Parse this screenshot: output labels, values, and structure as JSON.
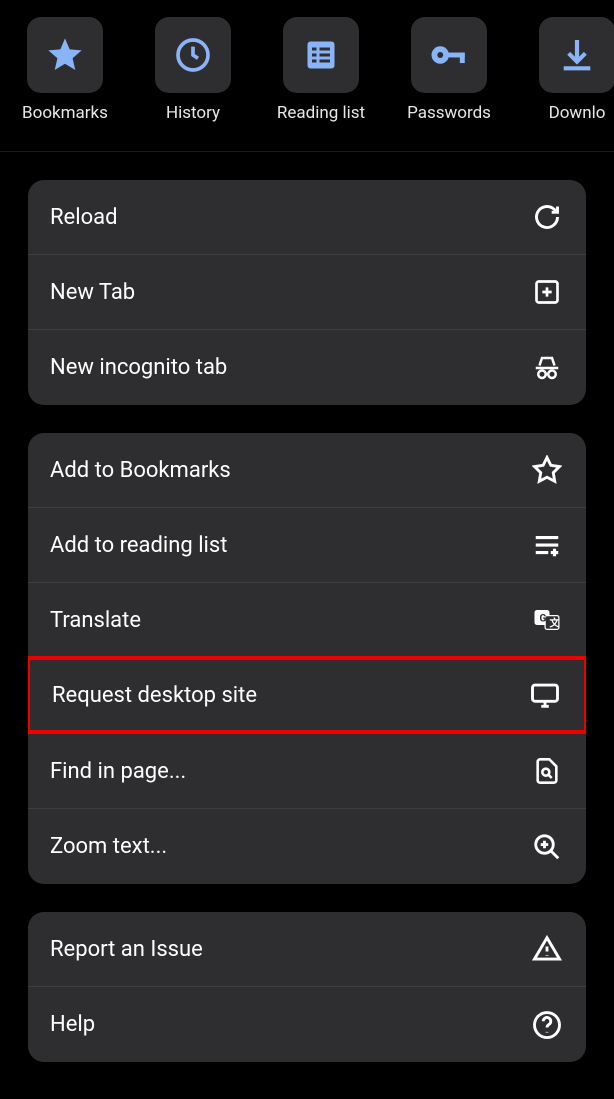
{
  "topRow": {
    "bookmarks": "Bookmarks",
    "history": "History",
    "readingList": "Reading list",
    "passwords": "Passwords",
    "downloads": "Downlo"
  },
  "section1": {
    "reload": "Reload",
    "newTab": "New Tab",
    "incognito": "New incognito tab"
  },
  "section2": {
    "addBookmarks": "Add to Bookmarks",
    "addReadingList": "Add to reading list",
    "translate": "Translate",
    "requestDesktop": "Request desktop site",
    "findInPage": "Find in page...",
    "zoomText": "Zoom text..."
  },
  "section3": {
    "reportIssue": "Report an Issue",
    "help": "Help"
  }
}
